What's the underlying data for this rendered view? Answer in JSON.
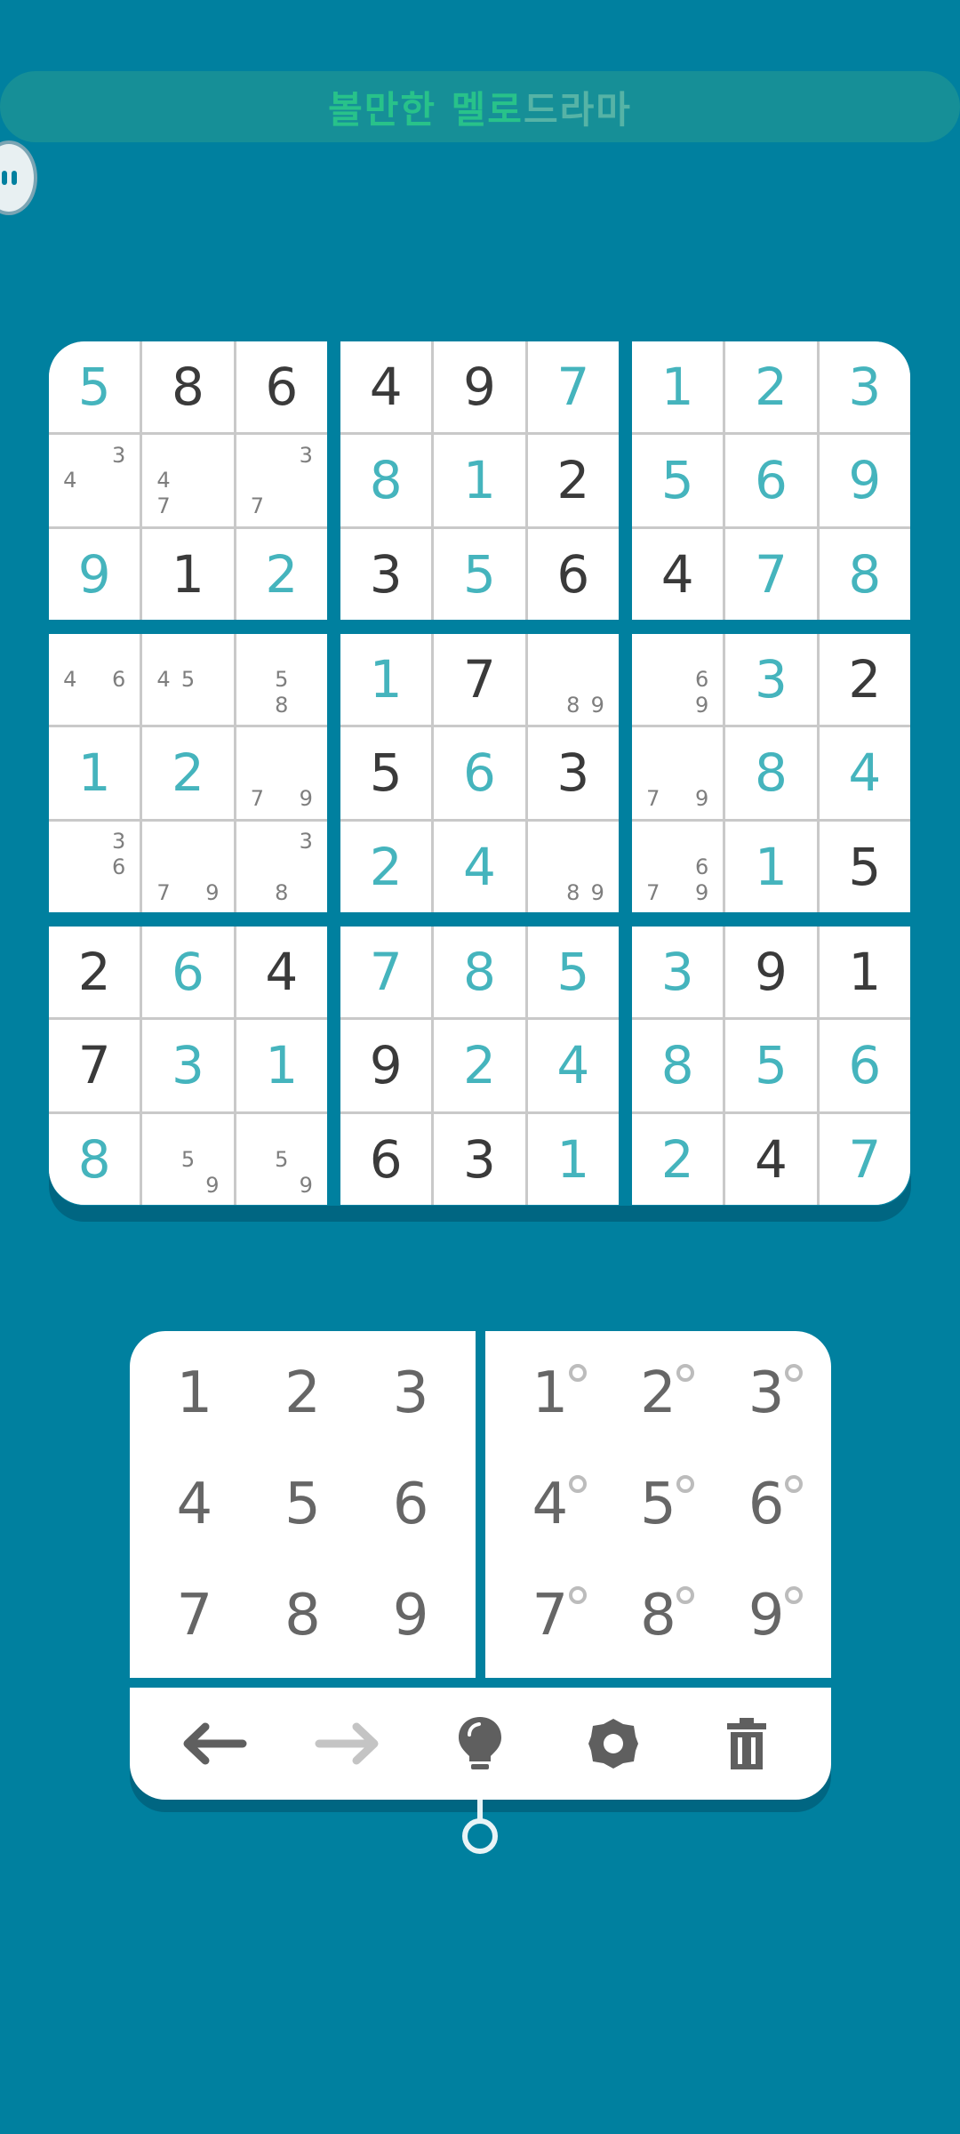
{
  "banner": {
    "text_main": "볼만한 멜로",
    "text_fade": "드라마"
  },
  "board": [
    [
      {
        "v": "5",
        "t": "user"
      },
      {
        "v": "8",
        "t": "given"
      },
      {
        "v": "6",
        "t": "given"
      },
      {
        "v": "4",
        "t": "given"
      },
      {
        "v": "9",
        "t": "given"
      },
      {
        "v": "7",
        "t": "user"
      },
      {
        "v": "1",
        "t": "user"
      },
      {
        "v": "2",
        "t": "user"
      },
      {
        "v": "3",
        "t": "user"
      }
    ],
    [
      {
        "n": [
          "4",
          "3"
        ]
      },
      {
        "n": [
          "4",
          "7"
        ]
      },
      {
        "n": [
          "3",
          "7"
        ]
      },
      {
        "v": "8",
        "t": "user"
      },
      {
        "v": "1",
        "t": "user"
      },
      {
        "v": "2",
        "t": "given"
      },
      {
        "v": "5",
        "t": "user"
      },
      {
        "v": "6",
        "t": "user"
      },
      {
        "v": "9",
        "t": "user"
      }
    ],
    [
      {
        "v": "9",
        "t": "user"
      },
      {
        "v": "1",
        "t": "given"
      },
      {
        "v": "2",
        "t": "user"
      },
      {
        "v": "3",
        "t": "given"
      },
      {
        "v": "5",
        "t": "user"
      },
      {
        "v": "6",
        "t": "given"
      },
      {
        "v": "4",
        "t": "given"
      },
      {
        "v": "7",
        "t": "user"
      },
      {
        "v": "8",
        "t": "user"
      }
    ],
    [
      {
        "n": [
          "4",
          "6"
        ]
      },
      {
        "n": [
          "4",
          "5"
        ]
      },
      {
        "n": [
          "5",
          "8"
        ]
      },
      {
        "v": "1",
        "t": "user"
      },
      {
        "v": "7",
        "t": "given"
      },
      {
        "n": [
          "8",
          "9"
        ]
      },
      {
        "n": [
          "6",
          "9"
        ]
      },
      {
        "v": "3",
        "t": "user"
      },
      {
        "v": "2",
        "t": "given"
      }
    ],
    [
      {
        "v": "1",
        "t": "user"
      },
      {
        "v": "2",
        "t": "user"
      },
      {
        "n": [
          "7",
          "9"
        ]
      },
      {
        "v": "5",
        "t": "given"
      },
      {
        "v": "6",
        "t": "user"
      },
      {
        "v": "3",
        "t": "given"
      },
      {
        "n": [
          "7",
          "9"
        ]
      },
      {
        "v": "8",
        "t": "user"
      },
      {
        "v": "4",
        "t": "user"
      }
    ],
    [
      {
        "n": [
          "3",
          "6"
        ]
      },
      {
        "n": [
          "7",
          "9"
        ]
      },
      {
        "n": [
          "3",
          "8"
        ]
      },
      {
        "v": "2",
        "t": "user"
      },
      {
        "v": "4",
        "t": "user"
      },
      {
        "n": [
          "8",
          "9"
        ]
      },
      {
        "n": [
          "7",
          "6",
          "9"
        ]
      },
      {
        "v": "1",
        "t": "user"
      },
      {
        "v": "5",
        "t": "given"
      }
    ],
    [
      {
        "v": "2",
        "t": "given"
      },
      {
        "v": "6",
        "t": "user"
      },
      {
        "v": "4",
        "t": "given"
      },
      {
        "v": "7",
        "t": "user"
      },
      {
        "v": "8",
        "t": "user"
      },
      {
        "v": "5",
        "t": "user"
      },
      {
        "v": "3",
        "t": "user"
      },
      {
        "v": "9",
        "t": "given"
      },
      {
        "v": "1",
        "t": "given"
      }
    ],
    [
      {
        "v": "7",
        "t": "given"
      },
      {
        "v": "3",
        "t": "user"
      },
      {
        "v": "1",
        "t": "user"
      },
      {
        "v": "9",
        "t": "given"
      },
      {
        "v": "2",
        "t": "user"
      },
      {
        "v": "4",
        "t": "user"
      },
      {
        "v": "8",
        "t": "user"
      },
      {
        "v": "5",
        "t": "user"
      },
      {
        "v": "6",
        "t": "user"
      }
    ],
    [
      {
        "v": "8",
        "t": "user"
      },
      {
        "n": [
          "5",
          "9"
        ]
      },
      {
        "n": [
          "5",
          "9"
        ]
      },
      {
        "v": "6",
        "t": "given"
      },
      {
        "v": "3",
        "t": "given"
      },
      {
        "v": "1",
        "t": "user"
      },
      {
        "v": "2",
        "t": "user"
      },
      {
        "v": "4",
        "t": "given"
      },
      {
        "v": "7",
        "t": "user"
      }
    ]
  ],
  "number_pad": [
    "1",
    "2",
    "3",
    "4",
    "5",
    "6",
    "7",
    "8",
    "9"
  ],
  "notes_pad": [
    "1",
    "2",
    "3",
    "4",
    "5",
    "6",
    "7",
    "8",
    "9"
  ],
  "toolbar": {
    "undo_icon": "arrow-left-icon",
    "redo_icon": "arrow-right-icon",
    "hint_icon": "lightbulb-icon",
    "settings_icon": "gear-icon",
    "erase_icon": "trash-icon"
  },
  "colors": {
    "background": "#00809f",
    "given": "#3a3a3a",
    "user": "#45b4bd",
    "note": "#7e7e7e",
    "banner_text": "#28c28a"
  }
}
